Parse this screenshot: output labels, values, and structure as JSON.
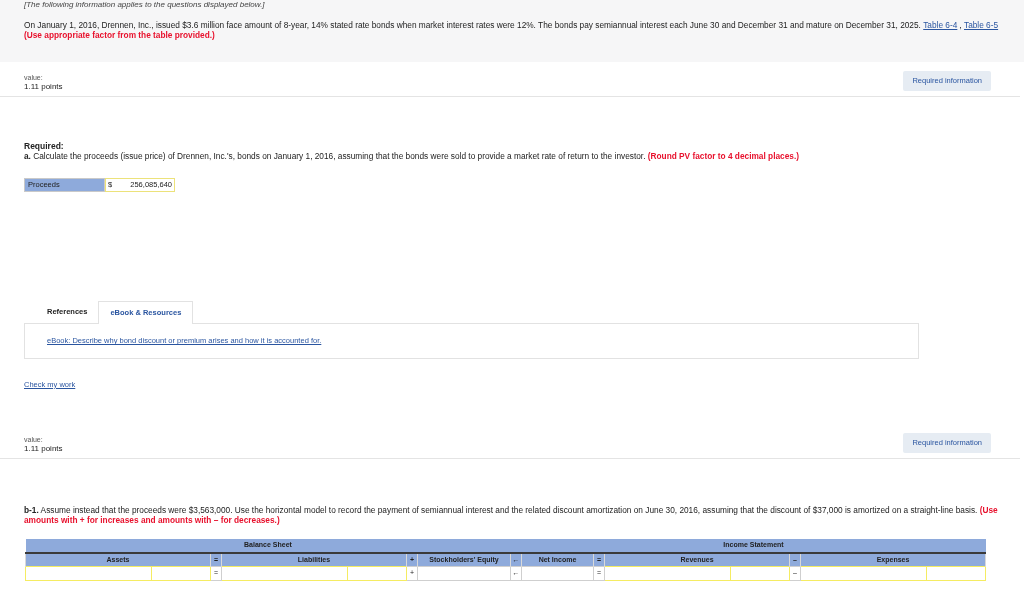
{
  "intro_note": "[The following information applies to the questions displayed below.]",
  "problem": {
    "text": "On January 1, 2016, Drennen, Inc., issued $3.6 million face amount of 8-year, 14% stated rate bonds when market interest rates were 12%. The bonds pay semiannual interest each June 30 and December 31 and mature on December 31, 2025.",
    "links": [
      "Table 6-4",
      "Table 6-5"
    ],
    "link_separator": ",",
    "instruction": "(Use appropriate factor from the table provided.)"
  },
  "part_a": {
    "value_label": "value:",
    "points": "1.11 points",
    "info_button": "Required information",
    "required_heading": "Required:",
    "question": "**a.** Calculate the proceeds (issue price) of Drennen, Inc.'s, bonds on January 1, 2016, assuming that the bonds were sold to provide a market rate of return to the investor.",
    "instruction": "(Round PV factor to 4 decimal places.)",
    "answer": {
      "label": "Proceeds",
      "currency": "$",
      "value": "256,085,640"
    },
    "tabs": [
      {
        "label": "References",
        "selected": false
      },
      {
        "label": "eBook & Resources",
        "selected": true
      }
    ],
    "ebook_link": "eBook: Describe why bond discount or premium arises and how it is accounted for.",
    "check_link": "Check my work"
  },
  "part_b": {
    "value_label": "value:",
    "points": "1.11 points",
    "info_button": "Required information",
    "question": "**b-1.** Assume instead that the proceeds were $3,563,000. Use the horizontal model to record the payment of semiannual interest and the related discount amortization on June 30, 2016, assuming that the discount of $37,000 is amortized on a straight-line basis.",
    "instruction": "(Use amounts with + for increases and amounts with – for decreases.)",
    "table": [
      {
        "kind": "group",
        "label": "Balance Sheet",
        "columns": [
          {
            "kind": "account",
            "label": "Assets",
            "fields": [
              {
                "highlighted": true
              },
              {
                "highlighted": true
              }
            ]
          },
          {
            "kind": "operator",
            "header": "=",
            "row": "="
          },
          {
            "kind": "account",
            "label": "Liabilities",
            "fields": [
              {
                "highlighted": true
              },
              {
                "highlighted": true
              }
            ]
          },
          {
            "kind": "operator",
            "header": "+",
            "row": "+"
          },
          {
            "kind": "account",
            "label": "Stockholders' Equity",
            "fields": [
              {
                "highlighted": false
              }
            ]
          }
        ]
      },
      {
        "kind": "operator",
        "header": "←",
        "row": "←"
      },
      {
        "kind": "group",
        "label": "Income Statement",
        "columns": [
          {
            "kind": "account",
            "label": "Net Income",
            "fields": [
              {
                "highlighted": false
              }
            ]
          },
          {
            "kind": "operator",
            "header": "=",
            "row": "="
          },
          {
            "kind": "account",
            "label": "Revenues",
            "fields": [
              {
                "highlighted": true
              },
              {
                "highlighted": true
              }
            ]
          },
          {
            "kind": "operator",
            "header": "–",
            "row": "–"
          },
          {
            "kind": "account",
            "label": "Expenses",
            "fields": [
              {
                "highlighted": true
              },
              {
                "highlighted": true
              }
            ]
          }
        ]
      }
    ]
  }
}
